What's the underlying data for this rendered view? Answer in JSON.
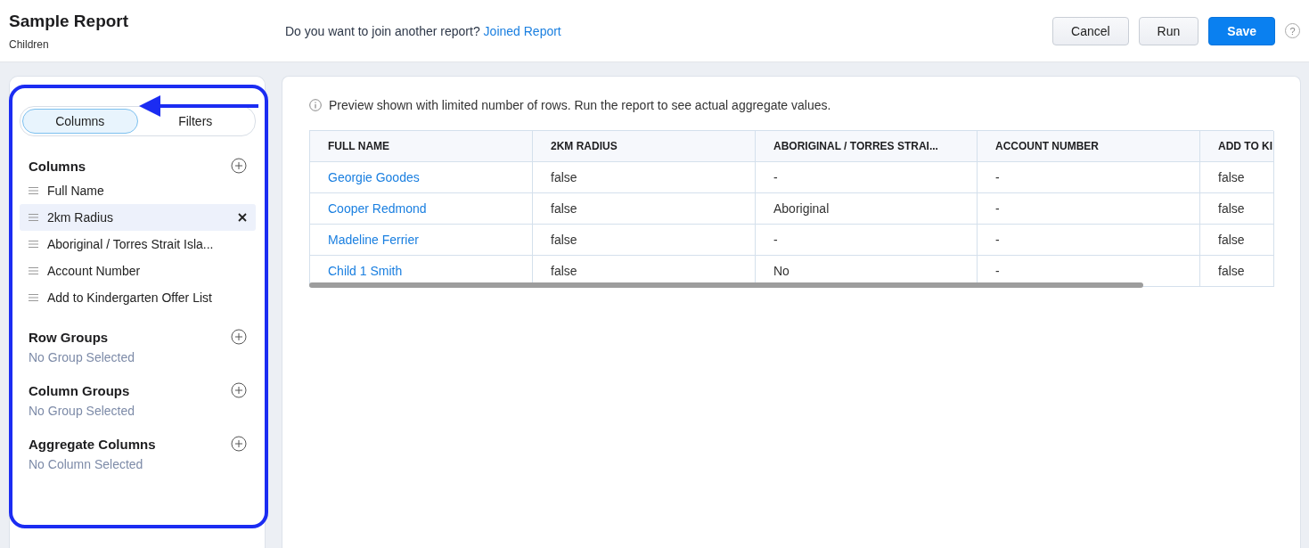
{
  "header": {
    "title": "Sample Report",
    "subtitle": "Children",
    "join_prompt": "Do you want to join another report?",
    "join_link": "Joined Report",
    "buttons": [
      {
        "label": "Cancel",
        "kind": "secondary"
      },
      {
        "label": "Run",
        "kind": "secondary"
      },
      {
        "label": "Save",
        "kind": "primary"
      }
    ],
    "help": "?"
  },
  "sidebar": {
    "tabs": [
      {
        "label": "Columns",
        "selected": true
      },
      {
        "label": "Filters",
        "selected": false
      }
    ],
    "sections": [
      {
        "title": "Columns",
        "items": [
          {
            "label": "Full Name",
            "selected": false
          },
          {
            "label": "2km Radius",
            "selected": true
          },
          {
            "label": "Aboriginal / Torres Strait Isla...",
            "selected": false
          },
          {
            "label": "Account Number",
            "selected": false
          },
          {
            "label": "Add to Kindergarten Offer List",
            "selected": false
          }
        ]
      },
      {
        "title": "Row Groups",
        "empty": "No Group Selected"
      },
      {
        "title": "Column Groups",
        "empty": "No Group Selected"
      },
      {
        "title": "Aggregate Columns",
        "empty": "No Column Selected"
      }
    ]
  },
  "preview": {
    "notice": "Preview shown with limited number of rows. Run the report to see actual aggregate values.",
    "table": {
      "columns": [
        "FULL NAME",
        "2KM RADIUS",
        "ABORIGINAL / TORRES STRAI...",
        "ACCOUNT NUMBER",
        "ADD TO KI"
      ],
      "rows": [
        [
          "Georgie Goodes",
          "false",
          "-",
          "-",
          "false"
        ],
        [
          "Cooper Redmond",
          "false",
          "Aboriginal",
          "-",
          "false"
        ],
        [
          "Madeline Ferrier",
          "false",
          "-",
          "-",
          "false"
        ],
        [
          "Child 1 Smith",
          "false",
          "No",
          "-",
          "false"
        ]
      ]
    }
  }
}
